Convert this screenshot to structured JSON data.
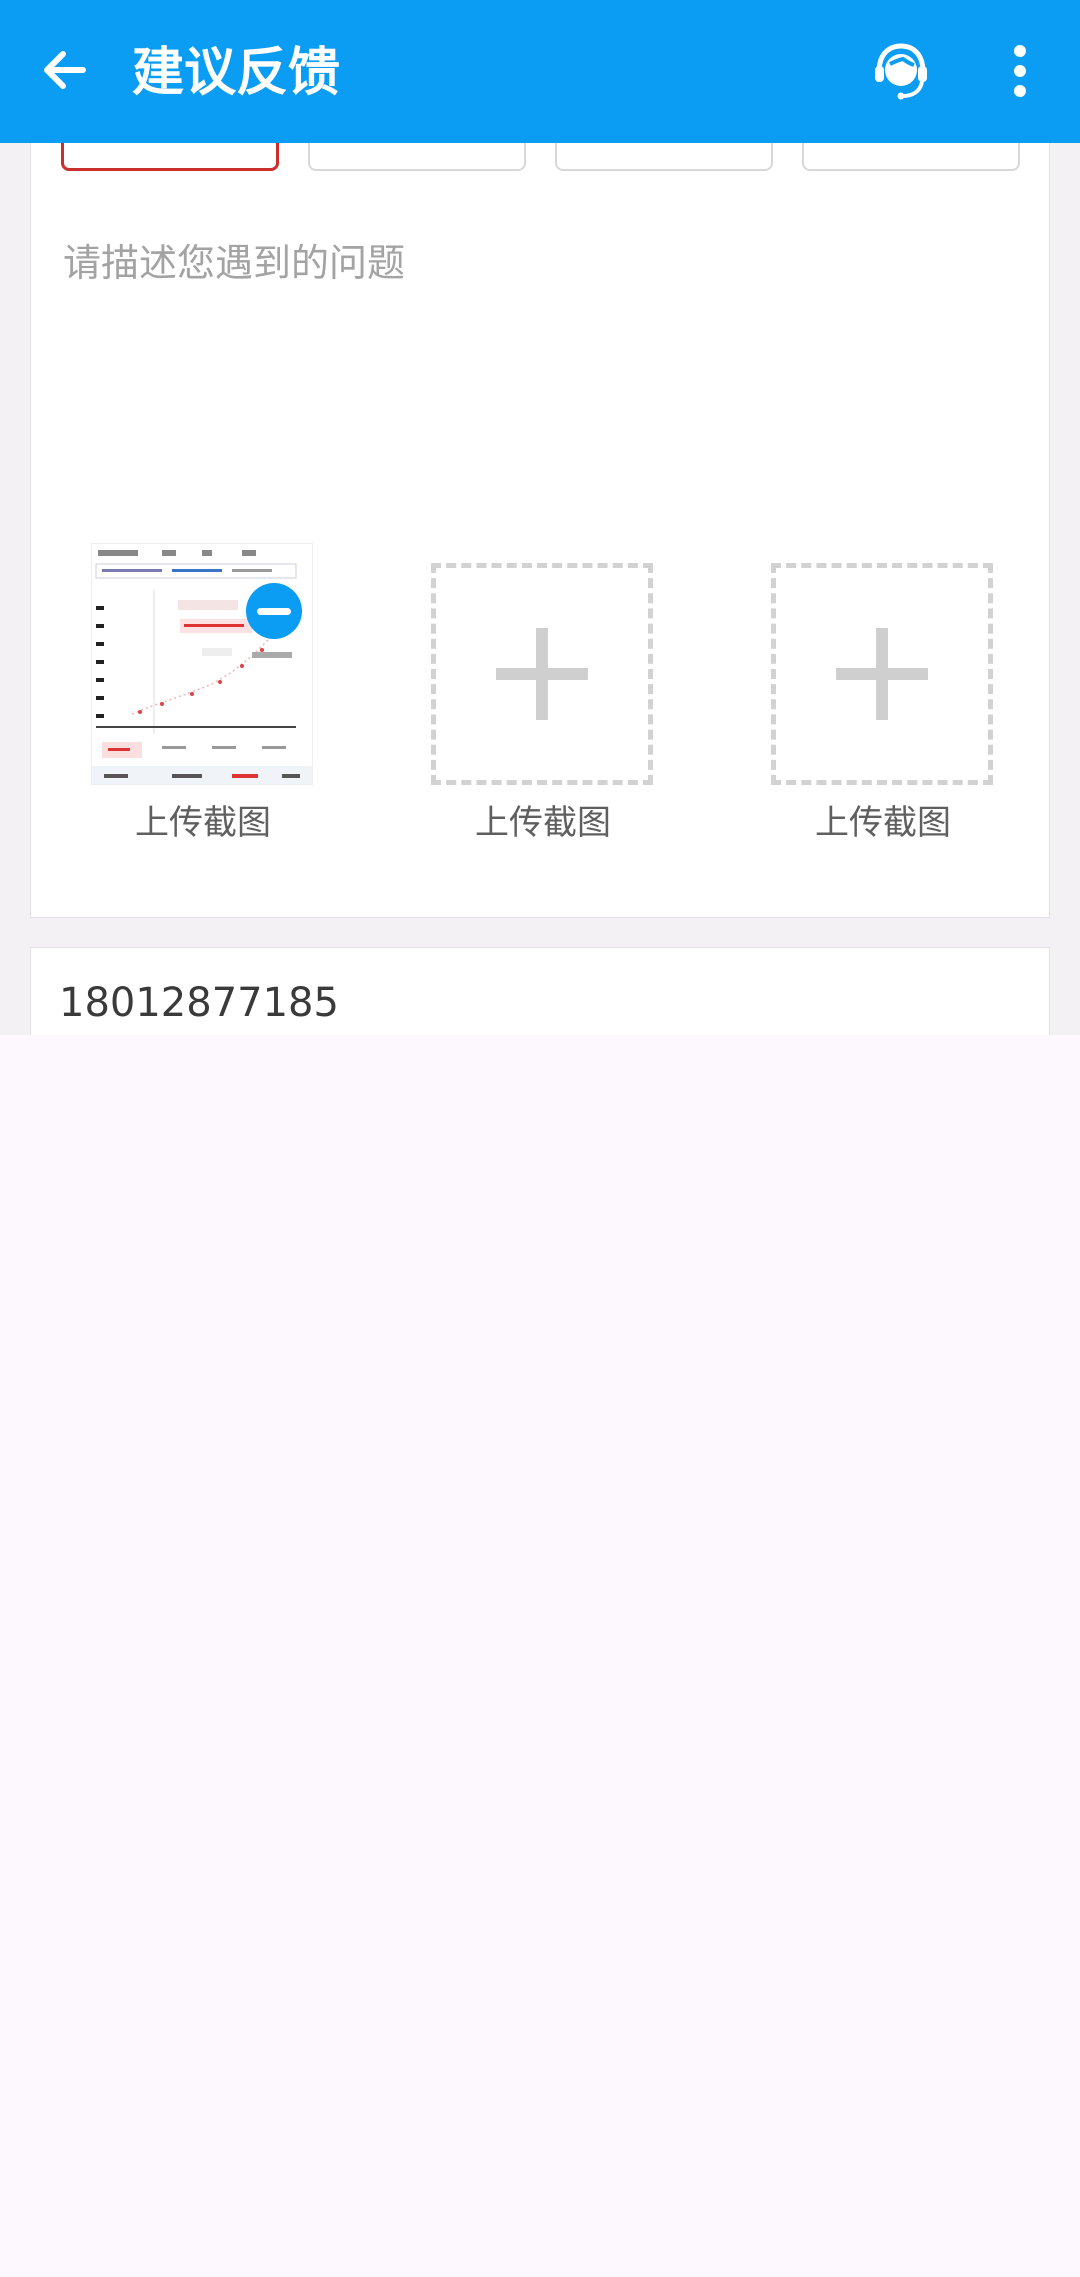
{
  "appbar": {
    "title": "建议反馈",
    "back_icon": "back-arrow-icon",
    "service_icon": "customer-service-icon",
    "more_icon": "more-vertical-icon",
    "color": "#0a9df3"
  },
  "feedback": {
    "description_placeholder": "请描述您遇到的问题",
    "uploads": [
      {
        "label": "上传截图",
        "has_image": true
      },
      {
        "label": "上传截图",
        "has_image": false
      },
      {
        "label": "上传截图",
        "has_image": false
      }
    ]
  },
  "contact": {
    "phone": "18012877185"
  },
  "colors": {
    "accent": "#0a9df3",
    "selected_border": "#c9302c"
  }
}
